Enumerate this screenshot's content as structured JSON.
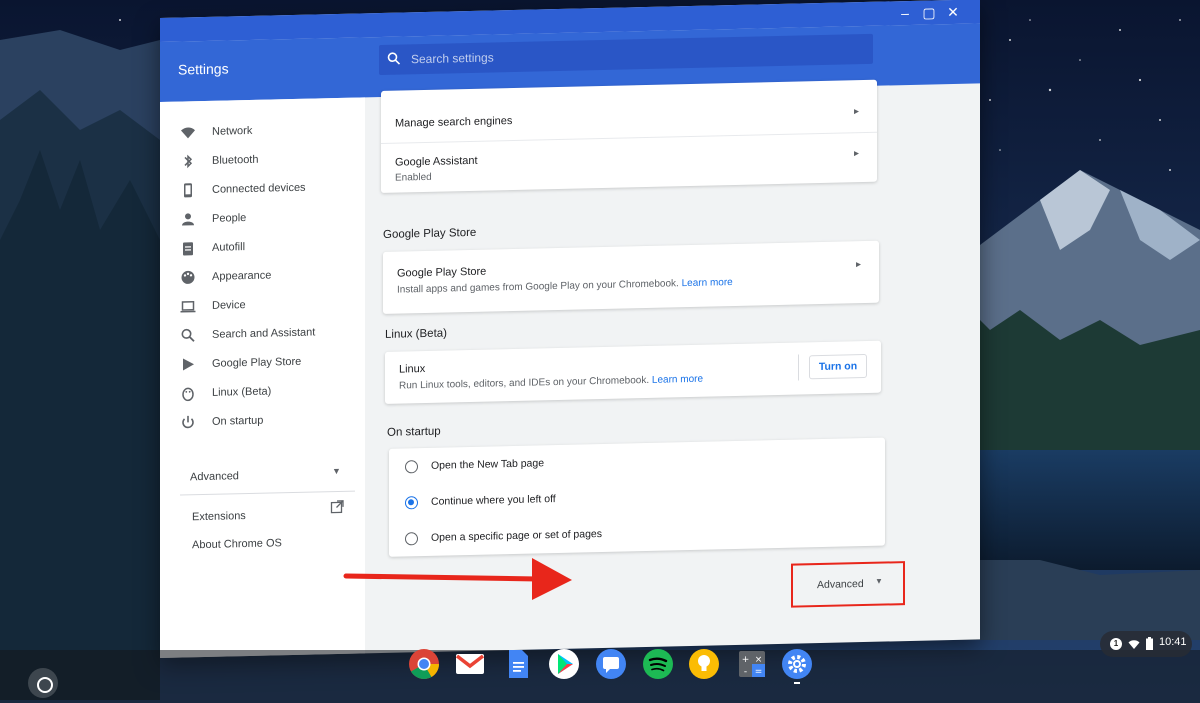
{
  "window": {
    "minimize_icon": "minimize-icon",
    "maximize_icon": "maximize-icon",
    "close_icon": "close-icon"
  },
  "header": {
    "title": "Settings",
    "search_placeholder": "Search settings"
  },
  "sidebar": {
    "items": [
      {
        "label": "Network",
        "icon": "wifi-icon"
      },
      {
        "label": "Bluetooth",
        "icon": "bluetooth-icon"
      },
      {
        "label": "Connected devices",
        "icon": "phone-icon"
      },
      {
        "label": "People",
        "icon": "person-icon"
      },
      {
        "label": "Autofill",
        "icon": "clipboard-icon"
      },
      {
        "label": "Appearance",
        "icon": "palette-icon"
      },
      {
        "label": "Device",
        "icon": "laptop-icon"
      },
      {
        "label": "Search and Assistant",
        "icon": "search-icon"
      },
      {
        "label": "Google Play Store",
        "icon": "play-icon"
      },
      {
        "label": "Linux (Beta)",
        "icon": "penguin-icon"
      },
      {
        "label": "On startup",
        "icon": "power-icon"
      }
    ],
    "advanced_label": "Advanced",
    "extensions_label": "Extensions",
    "about_label": "About Chrome OS"
  },
  "main": {
    "search_card": {
      "manage_engines": "Manage search engines",
      "assistant_title": "Google Assistant",
      "assistant_status": "Enabled"
    },
    "play_store": {
      "section_title": "Google Play Store",
      "row_title": "Google Play Store",
      "row_sub": "Install apps and games from Google Play on your Chromebook.",
      "learn_more": "Learn more"
    },
    "linux": {
      "section_title": "Linux (Beta)",
      "row_title": "Linux",
      "row_sub": "Run Linux tools, editors, and IDEs on your Chromebook.",
      "learn_more": "Learn more",
      "button": "Turn on"
    },
    "startup": {
      "section_title": "On startup",
      "options": [
        {
          "label": "Open the New Tab page",
          "selected": false
        },
        {
          "label": "Continue where you left off",
          "selected": true
        },
        {
          "label": "Open a specific page or set of pages",
          "selected": false
        }
      ]
    },
    "advanced_button": "Advanced"
  },
  "shelf": {
    "apps": [
      "chrome-icon",
      "gmail-icon",
      "docs-icon",
      "play-store-icon",
      "messages-icon",
      "spotify-icon",
      "keep-icon",
      "calculator-icon",
      "settings-icon"
    ]
  },
  "status": {
    "notifications": "1",
    "time": "10:41"
  },
  "colors": {
    "header_blue": "#3367d6",
    "titlebar_blue": "#2e5fd4",
    "accent": "#1a73e8",
    "highlight_red": "#e8261b"
  }
}
